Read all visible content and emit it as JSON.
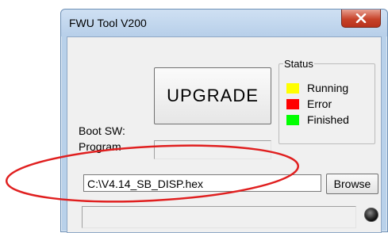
{
  "window": {
    "title": "FWU Tool V200",
    "close_icon": "close-icon"
  },
  "main": {
    "upgrade_label": "UPGRADE",
    "boot_sw_label": "Boot SW:",
    "program_label": "Program",
    "file_path": "C:\\V4.14_SB_DISP.hex",
    "browse_label": "Browse"
  },
  "status": {
    "legend": "Status",
    "items": [
      {
        "label": "Running",
        "color": "#ffff00"
      },
      {
        "label": "Error",
        "color": "#ff0000"
      },
      {
        "label": "Finished",
        "color": "#00ff00"
      }
    ]
  },
  "colors": {
    "annotation_ellipse": "#e01f1f",
    "led": "#111111"
  }
}
